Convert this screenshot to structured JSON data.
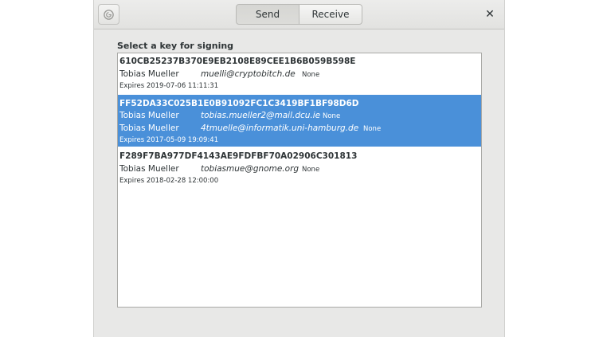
{
  "header": {
    "app_icon": "gnome-seahorse-icon",
    "tabs": [
      {
        "label": "Send",
        "selected": true
      },
      {
        "label": "Receive",
        "selected": false
      }
    ],
    "close_glyph": "✕"
  },
  "content": {
    "list_label": "Select a key for signing",
    "keys": [
      {
        "key_id": "610CB25237B370E9EB2108E89CEE1B6B059B598E",
        "uids": [
          {
            "name": "Tobias Mueller",
            "email": "muelli@cryptobitch.de",
            "trust": "None"
          }
        ],
        "expires": "Expires 2019-07-06 11:11:31",
        "selected": false
      },
      {
        "key_id": "FF52DA33C025B1E0B91092FC1C3419BF1BF98D6D",
        "uids": [
          {
            "name": "Tobias Mueller",
            "email": "tobias.mueller2@mail.dcu.ie",
            "trust": "None"
          },
          {
            "name": "Tobias Mueller",
            "email": "4tmuelle@informatik.uni-hamburg.de",
            "trust": "None"
          }
        ],
        "expires": "Expires 2017-05-09 19:09:41",
        "selected": true
      },
      {
        "key_id": "F289F7BA977DF4143AE9FDFBF70A02906C301813",
        "uids": [
          {
            "name": "Tobias Mueller",
            "email": "tobiasmue@gnome.org",
            "trust": "None"
          }
        ],
        "expires": "Expires 2018-02-28 12:00:00",
        "selected": false
      }
    ]
  },
  "colors": {
    "selection": "#4a90d9",
    "window_bg": "#e8e8e7",
    "text": "#2e3436"
  }
}
